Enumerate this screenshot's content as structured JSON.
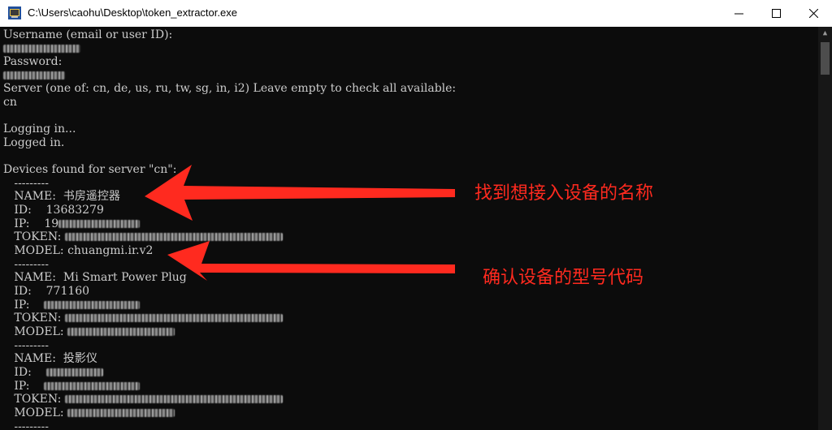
{
  "window": {
    "title": "C:\\Users\\caohu\\Desktop\\token_extractor.exe",
    "minimize_label": "—",
    "maximize_label": "☐",
    "close_label": "✕"
  },
  "console": {
    "username_prompt": "Username (email or user ID):",
    "password_prompt": "Password:",
    "server_prompt": "Server (one of: cn, de, us, ru, tw, sg, in, i2) Leave empty to check all available:",
    "server_input": "cn",
    "logging_in": "Logging in...",
    "logged_in": "Logged in.",
    "devices_found": "Devices found for server \"cn\":",
    "separator": "   ---------",
    "devices": [
      {
        "name_label": "   NAME:  ",
        "name": "书房遥控器",
        "id_label": "   ID:    ",
        "id": "13683279",
        "ip_label": "   IP:    ",
        "ip": "19",
        "token_label": "   TOKEN: ",
        "model_label": "   MODEL: ",
        "model": "chuangmi.ir.v2"
      },
      {
        "name_label": "   NAME:  ",
        "name": "Mi Smart Power Plug",
        "id_label": "   ID:    ",
        "id": "771160",
        "ip_label": "   IP:    ",
        "token_label": "   TOKEN: ",
        "model_label": "   MODEL: "
      },
      {
        "name_label": "   NAME:  ",
        "name": "投影仪",
        "id_label": "   ID:    ",
        "ip_label": "   IP:    ",
        "token_label": "   TOKEN: ",
        "model_label": "   MODEL: "
      }
    ]
  },
  "annotations": {
    "find_device": "找到想接入设备的名称",
    "confirm_model": "确认设备的型号代码",
    "color": "#ff2a1f"
  }
}
